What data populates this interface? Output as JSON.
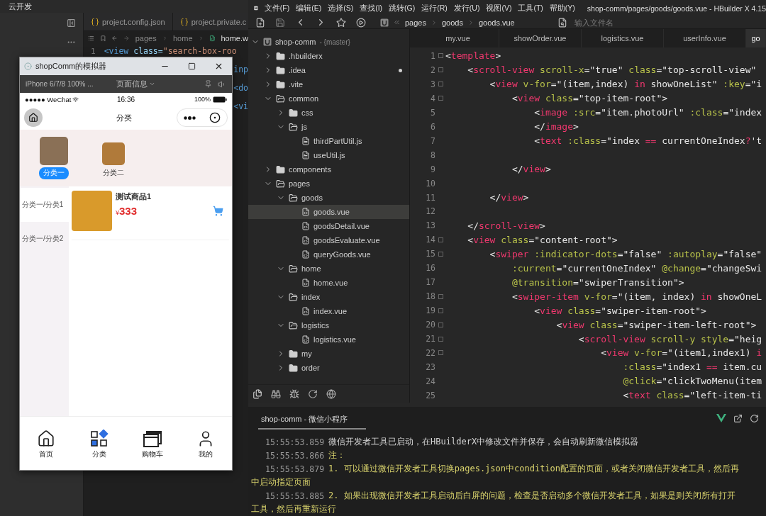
{
  "devtools": {
    "menu": [
      "云开发"
    ],
    "tabs": [
      {
        "label": "project.config.json",
        "selected": false
      },
      {
        "label": "project.private.c",
        "selected": false
      }
    ],
    "breadcrumb": [
      "pages",
      "home",
      "home.w"
    ],
    "code": [
      {
        "number": "1",
        "kind": "full",
        "segments": [
          {
            "kind": "tag",
            "text": "<view"
          },
          {
            "kind": "attr",
            "text": " class="
          },
          {
            "kind": "str",
            "text": "\"search-box-roo"
          }
        ]
      },
      {
        "kind": "fragment",
        "segments": [
          {
            "kind": "tag",
            "text": "inp"
          }
        ]
      },
      {
        "kind": "fragment",
        "segments": [
          {
            "kind": "tag",
            "text": "<do"
          }
        ]
      },
      {
        "kind": "fragment",
        "segments": [
          {
            "kind": "tag",
            "text": "<vi"
          }
        ]
      }
    ]
  },
  "simulator": {
    "title": "shopComm的模拟器",
    "device": "iPhone 6/7/8 100% ...",
    "page_info": "页面信息",
    "status_bar": {
      "carrier": "●●●●● WeChat",
      "time": "16:36",
      "battery": "100%"
    },
    "nav_title": "分类",
    "categories": [
      {
        "label": "分类一",
        "selected": true
      },
      {
        "label": "分类二",
        "selected": false
      }
    ],
    "sub_menu": [
      {
        "label": "分类一/分类1",
        "selected": true
      },
      {
        "label": "分类一/分类2",
        "selected": false
      }
    ],
    "products": [
      {
        "name": "测试商品1",
        "currency": "¥",
        "price": "333"
      }
    ],
    "tab_bar": [
      {
        "kind": "home",
        "label": "首页",
        "selected": false
      },
      {
        "kind": "category",
        "label": "分类",
        "selected": true
      },
      {
        "kind": "cart",
        "label": "购物车",
        "selected": false
      },
      {
        "kind": "profile",
        "label": "我的",
        "selected": false
      }
    ]
  },
  "hbuilder": {
    "menu": [
      "文件(F)",
      "编辑(E)",
      "选择(S)",
      "查找(I)",
      "跳转(G)",
      "运行(R)",
      "发行(U)",
      "视图(V)",
      "工具(T)",
      "帮助(Y)"
    ],
    "title": "shop-comm/pages/goods/goods.vue - HBuilder X 4.15",
    "breadcrumb": [
      "pages",
      "goods",
      "goods.vue"
    ],
    "search": {
      "placeholder": "输入文件名"
    },
    "tabs": [
      {
        "label": "my.vue",
        "selected": false
      },
      {
        "label": "showOrder.vue",
        "selected": false
      },
      {
        "label": "logistics.vue",
        "selected": false
      },
      {
        "label": "userInfo.vue",
        "selected": false
      },
      {
        "label": "go",
        "selected": true
      }
    ],
    "tree": {
      "kind": "project",
      "name": "shop-comm",
      "branch": " - {master}",
      "expanded": true,
      "selected": false,
      "modified": false,
      "children": [
        {
          "kind": "folder",
          "name": ".hbuilderx",
          "expanded": false,
          "selected": false,
          "modified": false
        },
        {
          "kind": "folder",
          "name": ".idea",
          "expanded": false,
          "selected": false,
          "modified": true
        },
        {
          "kind": "folder",
          "name": ".vite",
          "expanded": false,
          "selected": false,
          "modified": false
        },
        {
          "kind": "folder",
          "name": "common",
          "expanded": true,
          "selected": false,
          "modified": false,
          "children": [
            {
              "kind": "folder",
              "name": "css",
              "expanded": false,
              "selected": false,
              "modified": false
            },
            {
              "kind": "folder",
              "name": "js",
              "expanded": true,
              "selected": false,
              "modified": false,
              "children": [
                {
                  "kind": "file",
                  "name": "thirdPartUtil.js",
                  "selected": false,
                  "modified": false
                },
                {
                  "kind": "file",
                  "name": "useUtil.js",
                  "selected": false,
                  "modified": false
                }
              ]
            }
          ]
        },
        {
          "kind": "folder",
          "name": "components",
          "expanded": false,
          "selected": false,
          "modified": false
        },
        {
          "kind": "folder",
          "name": "pages",
          "expanded": true,
          "selected": false,
          "modified": false,
          "children": [
            {
              "kind": "folder",
              "name": "goods",
              "expanded": true,
              "selected": false,
              "modified": false,
              "children": [
                {
                  "kind": "file",
                  "name": "goods.vue",
                  "selected": true,
                  "modified": false
                },
                {
                  "kind": "file",
                  "name": "goodsDetail.vue",
                  "selected": false,
                  "modified": false
                },
                {
                  "kind": "file",
                  "name": "goodsEvaluate.vue",
                  "selected": false,
                  "modified": false
                },
                {
                  "kind": "file",
                  "name": "queryGoods.vue",
                  "selected": false,
                  "modified": false
                }
              ]
            },
            {
              "kind": "folder",
              "name": "home",
              "expanded": true,
              "selected": false,
              "modified": false,
              "children": [
                {
                  "kind": "file",
                  "name": "home.vue",
                  "selected": false,
                  "modified": false
                }
              ]
            },
            {
              "kind": "folder",
              "name": "index",
              "expanded": true,
              "selected": false,
              "modified": false,
              "children": [
                {
                  "kind": "file",
                  "name": "index.vue",
                  "selected": false,
                  "modified": false
                }
              ]
            },
            {
              "kind": "folder",
              "name": "logistics",
              "expanded": true,
              "selected": false,
              "modified": false,
              "children": [
                {
                  "kind": "file",
                  "name": "logistics.vue",
                  "selected": false,
                  "modified": false
                }
              ]
            },
            {
              "kind": "folder",
              "name": "my",
              "expanded": false,
              "selected": false,
              "modified": false
            },
            {
              "kind": "folder",
              "name": "order",
              "expanded": false,
              "selected": false,
              "modified": false
            }
          ]
        }
      ]
    },
    "code": [
      {
        "number": "1",
        "foldable": true,
        "segments": [
          {
            "kind": "p",
            "text": "<"
          },
          {
            "kind": "tag",
            "text": "template"
          },
          {
            "kind": "p",
            "text": ">"
          }
        ]
      },
      {
        "number": "2",
        "foldable": true,
        "segments": [
          {
            "kind": "p",
            "text": "    <"
          },
          {
            "kind": "tag",
            "text": "scroll-view"
          },
          {
            "kind": "attr",
            "text": " scroll-x"
          },
          {
            "kind": "p",
            "text": "="
          },
          {
            "kind": "str",
            "text": "\"true\""
          },
          {
            "kind": "attr",
            "text": " class"
          },
          {
            "kind": "p",
            "text": "="
          },
          {
            "kind": "str",
            "text": "\"top-scroll-view\""
          }
        ]
      },
      {
        "number": "3",
        "foldable": true,
        "segments": [
          {
            "kind": "p",
            "text": "        <"
          },
          {
            "kind": "tag",
            "text": "view"
          },
          {
            "kind": "attr",
            "text": " v-for"
          },
          {
            "kind": "p",
            "text": "="
          },
          {
            "kind": "str",
            "text": "\"(item,index) "
          },
          {
            "kind": "tag",
            "text": "in"
          },
          {
            "kind": "str",
            "text": " showOneList\""
          },
          {
            "kind": "attr",
            "text": " :key"
          },
          {
            "kind": "p",
            "text": "="
          },
          {
            "kind": "str",
            "text": "\"i"
          }
        ]
      },
      {
        "number": "4",
        "foldable": true,
        "segments": [
          {
            "kind": "p",
            "text": "            <"
          },
          {
            "kind": "tag",
            "text": "view"
          },
          {
            "kind": "attr",
            "text": " class"
          },
          {
            "kind": "p",
            "text": "="
          },
          {
            "kind": "str",
            "text": "\"top-item-root\""
          },
          {
            "kind": "p",
            "text": ">"
          }
        ]
      },
      {
        "number": "5",
        "foldable": false,
        "segments": [
          {
            "kind": "p",
            "text": "                <"
          },
          {
            "kind": "tag",
            "text": "image"
          },
          {
            "kind": "attr",
            "text": " :src"
          },
          {
            "kind": "p",
            "text": "="
          },
          {
            "kind": "str",
            "text": "\"item.photoUrl\""
          },
          {
            "kind": "attr",
            "text": " :class"
          },
          {
            "kind": "p",
            "text": "="
          },
          {
            "kind": "str",
            "text": "\"index"
          }
        ]
      },
      {
        "number": "6",
        "foldable": false,
        "segments": [
          {
            "kind": "p",
            "text": "                </"
          },
          {
            "kind": "tag",
            "text": "image"
          },
          {
            "kind": "p",
            "text": ">"
          }
        ]
      },
      {
        "number": "7",
        "foldable": false,
        "segments": [
          {
            "kind": "p",
            "text": "                <"
          },
          {
            "kind": "tag",
            "text": "text"
          },
          {
            "kind": "attr",
            "text": " :class"
          },
          {
            "kind": "p",
            "text": "="
          },
          {
            "kind": "str",
            "text": "\"index "
          },
          {
            "kind": "tag",
            "text": "=="
          },
          {
            "kind": "str",
            "text": " currentOneIndex"
          },
          {
            "kind": "tag",
            "text": "?"
          },
          {
            "kind": "str",
            "text": "'t"
          }
        ]
      },
      {
        "number": "8",
        "foldable": false
      },
      {
        "number": "9",
        "foldable": false,
        "segments": [
          {
            "kind": "p",
            "text": "            </"
          },
          {
            "kind": "tag",
            "text": "view"
          },
          {
            "kind": "p",
            "text": ">"
          }
        ]
      },
      {
        "number": "10",
        "foldable": false
      },
      {
        "number": "11",
        "foldable": false,
        "segments": [
          {
            "kind": "p",
            "text": "        </"
          },
          {
            "kind": "tag",
            "text": "view"
          },
          {
            "kind": "p",
            "text": ">"
          }
        ]
      },
      {
        "number": "12",
        "foldable": false
      },
      {
        "number": "13",
        "foldable": false,
        "segments": [
          {
            "kind": "p",
            "text": "    </"
          },
          {
            "kind": "tag",
            "text": "scroll-view"
          },
          {
            "kind": "p",
            "text": ">"
          }
        ]
      },
      {
        "number": "14",
        "foldable": true,
        "segments": [
          {
            "kind": "p",
            "text": "    <"
          },
          {
            "kind": "tag",
            "text": "view"
          },
          {
            "kind": "attr",
            "text": " class"
          },
          {
            "kind": "p",
            "text": "="
          },
          {
            "kind": "str",
            "text": "\"content-root\""
          },
          {
            "kind": "p",
            "text": ">"
          }
        ]
      },
      {
        "number": "15",
        "foldable": true,
        "segments": [
          {
            "kind": "p",
            "text": "        <"
          },
          {
            "kind": "tag",
            "text": "swiper"
          },
          {
            "kind": "attr",
            "text": " :indicator-dots"
          },
          {
            "kind": "p",
            "text": "="
          },
          {
            "kind": "str",
            "text": "\"false\""
          },
          {
            "kind": "attr",
            "text": " :autoplay"
          },
          {
            "kind": "p",
            "text": "="
          },
          {
            "kind": "str",
            "text": "\"false\""
          }
        ]
      },
      {
        "number": "16",
        "foldable": false,
        "segments": [
          {
            "kind": "attr",
            "text": "            :current"
          },
          {
            "kind": "p",
            "text": "="
          },
          {
            "kind": "str",
            "text": "\"currentOneIndex\""
          },
          {
            "kind": "attr",
            "text": " @change"
          },
          {
            "kind": "p",
            "text": "="
          },
          {
            "kind": "str",
            "text": "\"changeSwi"
          }
        ]
      },
      {
        "number": "17",
        "foldable": false,
        "segments": [
          {
            "kind": "attr",
            "text": "            @transition"
          },
          {
            "kind": "p",
            "text": "="
          },
          {
            "kind": "str",
            "text": "\"swiperTransition\""
          },
          {
            "kind": "p",
            "text": ">"
          }
        ]
      },
      {
        "number": "18",
        "foldable": true,
        "segments": [
          {
            "kind": "p",
            "text": "            <"
          },
          {
            "kind": "tag",
            "text": "swiper-item"
          },
          {
            "kind": "attr",
            "text": " v-for"
          },
          {
            "kind": "p",
            "text": "="
          },
          {
            "kind": "str",
            "text": "\"(item, index) "
          },
          {
            "kind": "tag",
            "text": "in"
          },
          {
            "kind": "str",
            "text": " showOneL"
          }
        ]
      },
      {
        "number": "19",
        "foldable": true,
        "segments": [
          {
            "kind": "p",
            "text": "                <"
          },
          {
            "kind": "tag",
            "text": "view"
          },
          {
            "kind": "attr",
            "text": " class"
          },
          {
            "kind": "p",
            "text": "="
          },
          {
            "kind": "str",
            "text": "\"swiper-item-root\""
          },
          {
            "kind": "p",
            "text": ">"
          }
        ]
      },
      {
        "number": "20",
        "foldable": true,
        "segments": [
          {
            "kind": "p",
            "text": "                    <"
          },
          {
            "kind": "tag",
            "text": "view"
          },
          {
            "kind": "attr",
            "text": " class"
          },
          {
            "kind": "p",
            "text": "="
          },
          {
            "kind": "str",
            "text": "\"swiper-item-left-root\""
          },
          {
            "kind": "p",
            "text": ">"
          }
        ]
      },
      {
        "number": "21",
        "foldable": true,
        "segments": [
          {
            "kind": "p",
            "text": "                        <"
          },
          {
            "kind": "tag",
            "text": "scroll-view"
          },
          {
            "kind": "attr",
            "text": " scroll-y style"
          },
          {
            "kind": "p",
            "text": "="
          },
          {
            "kind": "str",
            "text": "\"heig"
          }
        ]
      },
      {
        "number": "22",
        "foldable": true,
        "segments": [
          {
            "kind": "p",
            "text": "                            <"
          },
          {
            "kind": "tag",
            "text": "view"
          },
          {
            "kind": "attr",
            "text": " v-for"
          },
          {
            "kind": "p",
            "text": "="
          },
          {
            "kind": "str",
            "text": "\"(item1,index1) "
          },
          {
            "kind": "tag",
            "text": "i"
          }
        ]
      },
      {
        "number": "23",
        "foldable": false,
        "segments": [
          {
            "kind": "attr",
            "text": "                                :class"
          },
          {
            "kind": "p",
            "text": "="
          },
          {
            "kind": "str",
            "text": "\"index1 "
          },
          {
            "kind": "tag",
            "text": "=="
          },
          {
            "kind": "str",
            "text": " item.cu"
          }
        ]
      },
      {
        "number": "24",
        "foldable": false,
        "segments": [
          {
            "kind": "attr",
            "text": "                                @click"
          },
          {
            "kind": "p",
            "text": "="
          },
          {
            "kind": "str",
            "text": "\"clickTwoMenu(item"
          }
        ]
      },
      {
        "number": "25",
        "foldable": false,
        "segments": [
          {
            "kind": "p",
            "text": "                                <"
          },
          {
            "kind": "tag",
            "text": "text"
          },
          {
            "kind": "attr",
            "text": " class"
          },
          {
            "kind": "p",
            "text": "="
          },
          {
            "kind": "str",
            "text": "\"left-item-ti"
          }
        ]
      }
    ],
    "console": {
      "tabs": [
        {
          "label": "shop-comm - 微信小程序",
          "selected": true
        }
      ],
      "lines": [
        {
          "time": "15:55:53.859",
          "kind": "info",
          "text": "微信开发者工具已启动，在HBuilderX中修改文件并保存，会自动刷新微信模拟器"
        },
        {
          "time": "15:55:53.866",
          "kind": "warn",
          "text": "注："
        },
        {
          "time": "15:55:53.879",
          "kind": "warn",
          "text": "1. 可以通过微信开发者工具切换pages.json中condition配置的页面，或者关闭微信开发者工具，然后再",
          "continuation": "中启动指定页面"
        },
        {
          "time": "15:55:53.885",
          "kind": "warn",
          "text": "2. 如果出现微信开发者工具启动后白屏的问题，检查是否启动多个微信开发者工具，如果是则关闭所有打开",
          "continuation": "工具，然后再重新运行"
        }
      ]
    }
  }
}
